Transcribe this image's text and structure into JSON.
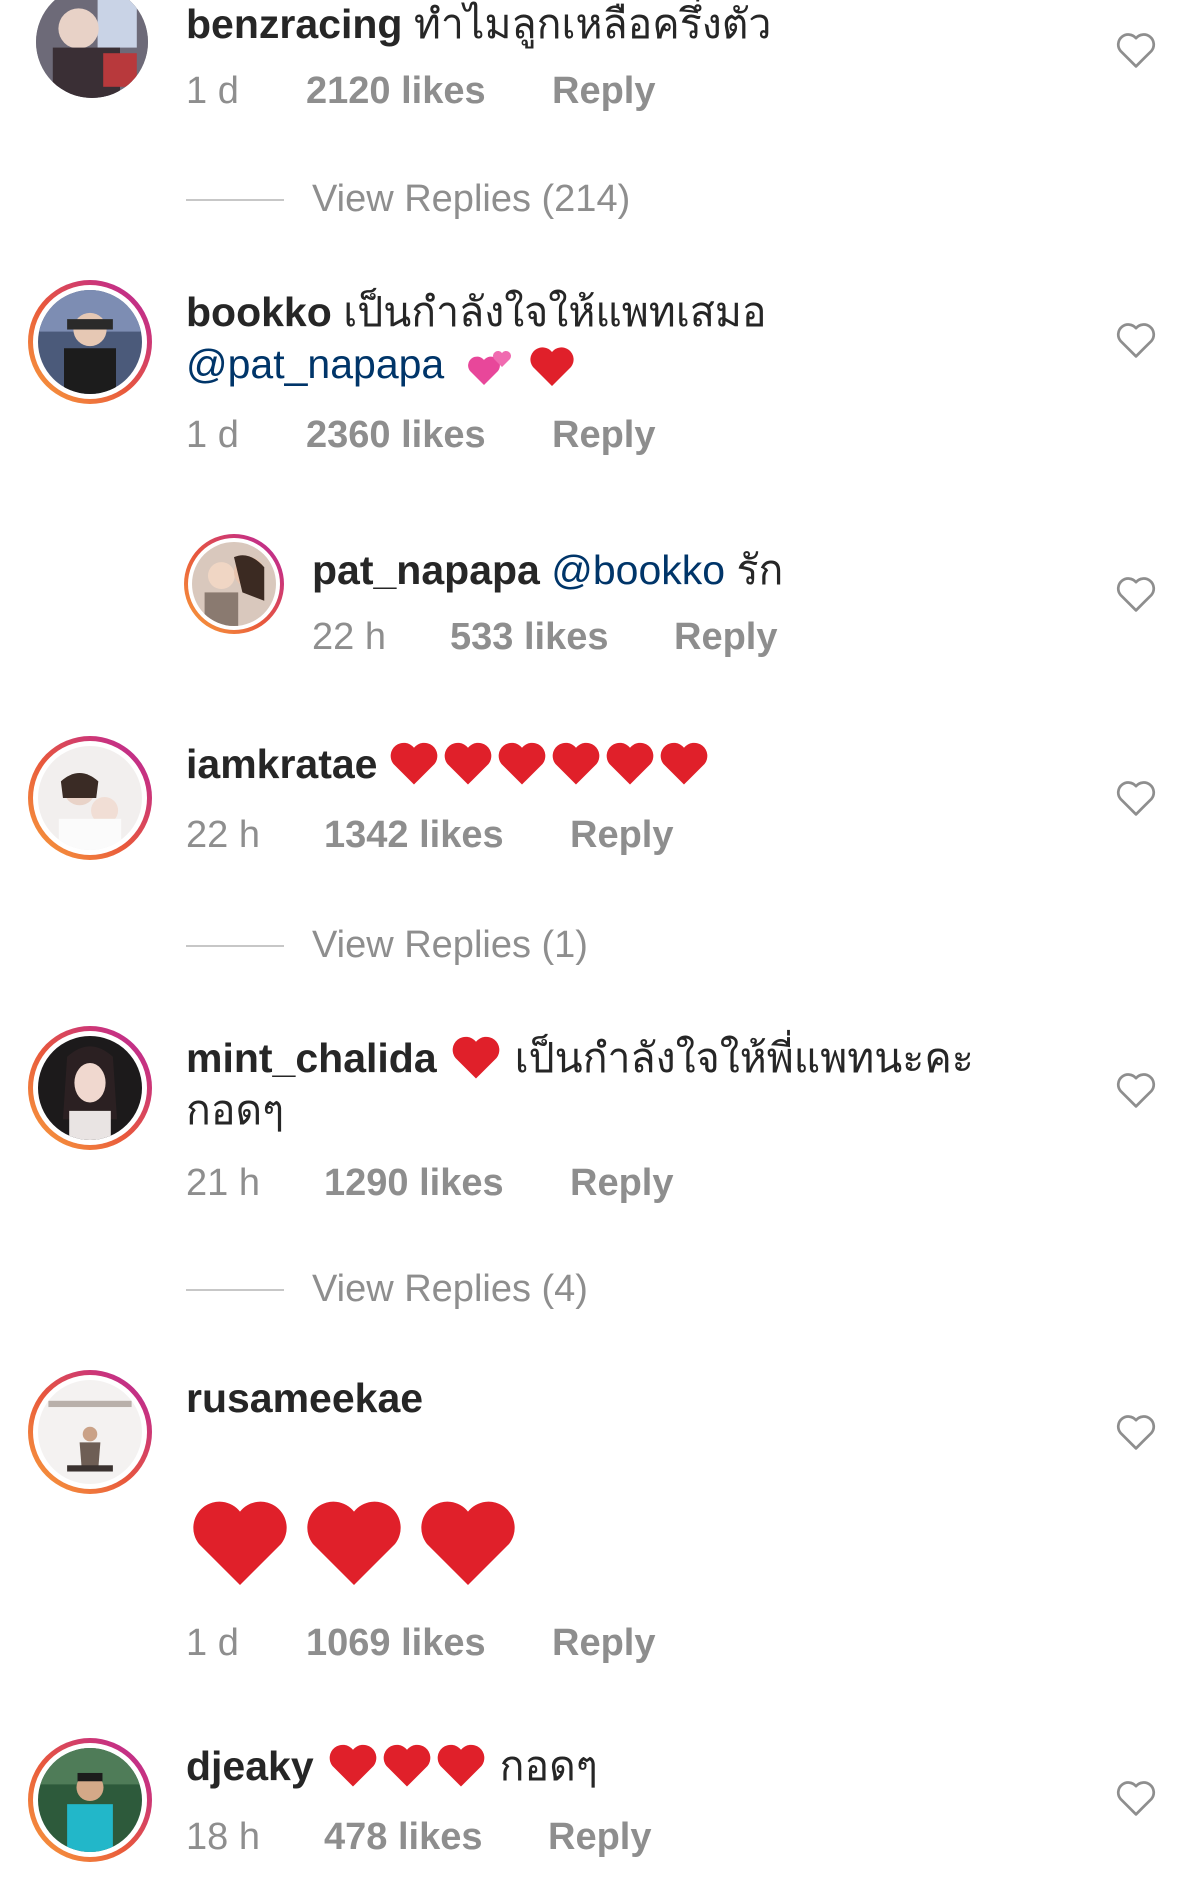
{
  "comments": [
    {
      "username": "benzracing",
      "text": "ทำไมลูกเหลือครึ่งตัว",
      "time": "1 d",
      "likes": "2120 likes",
      "reply": "Reply",
      "view_replies": "View Replies (214)"
    },
    {
      "username": "bookko",
      "text_line1": "เป็นกำลังใจให้แพทเสมอ",
      "mention": "@pat_napapa",
      "time": "1 d",
      "likes": "2360 likes",
      "reply": "Reply",
      "emoji": [
        "two-hearts",
        "red-heart"
      ],
      "replies": [
        {
          "username": "pat_napapa",
          "mention": "@bookko",
          "text": "รัก",
          "time": "22 h",
          "likes": "533 likes",
          "reply": "Reply"
        }
      ]
    },
    {
      "username": "iamkratae",
      "emoji": [
        "red-heart",
        "red-heart",
        "red-heart",
        "red-heart",
        "red-heart",
        "red-heart"
      ],
      "time": "22 h",
      "likes": "1342 likes",
      "reply": "Reply",
      "view_replies": "View Replies (1)"
    },
    {
      "username": "mint_chalida",
      "emoji": [
        "red-heart"
      ],
      "text_line1": "เป็นกำลังใจให้พี่แพทนะคะ",
      "text_line2": "กอดๆ",
      "time": "21 h",
      "likes": "1290 likes",
      "reply": "Reply",
      "view_replies": "View Replies (4)"
    },
    {
      "username": "rusameekae",
      "emoji": [
        "red-heart",
        "red-heart",
        "red-heart"
      ],
      "time": "1 d",
      "likes": "1069 likes",
      "reply": "Reply"
    },
    {
      "username": "djeaky",
      "emoji": [
        "red-heart",
        "red-heart",
        "red-heart"
      ],
      "text": "กอดๆ",
      "time": "18 h",
      "likes": "478 likes",
      "reply": "Reply"
    }
  ],
  "colors": {
    "text": "#262626",
    "meta": "#8e8e8e",
    "mention": "#003569",
    "heart_emoji": "#e0202a",
    "story_ring": "#d6306f"
  },
  "icons": {
    "like": "heart-outline-icon",
    "emoji": "red-heart-emoji"
  }
}
